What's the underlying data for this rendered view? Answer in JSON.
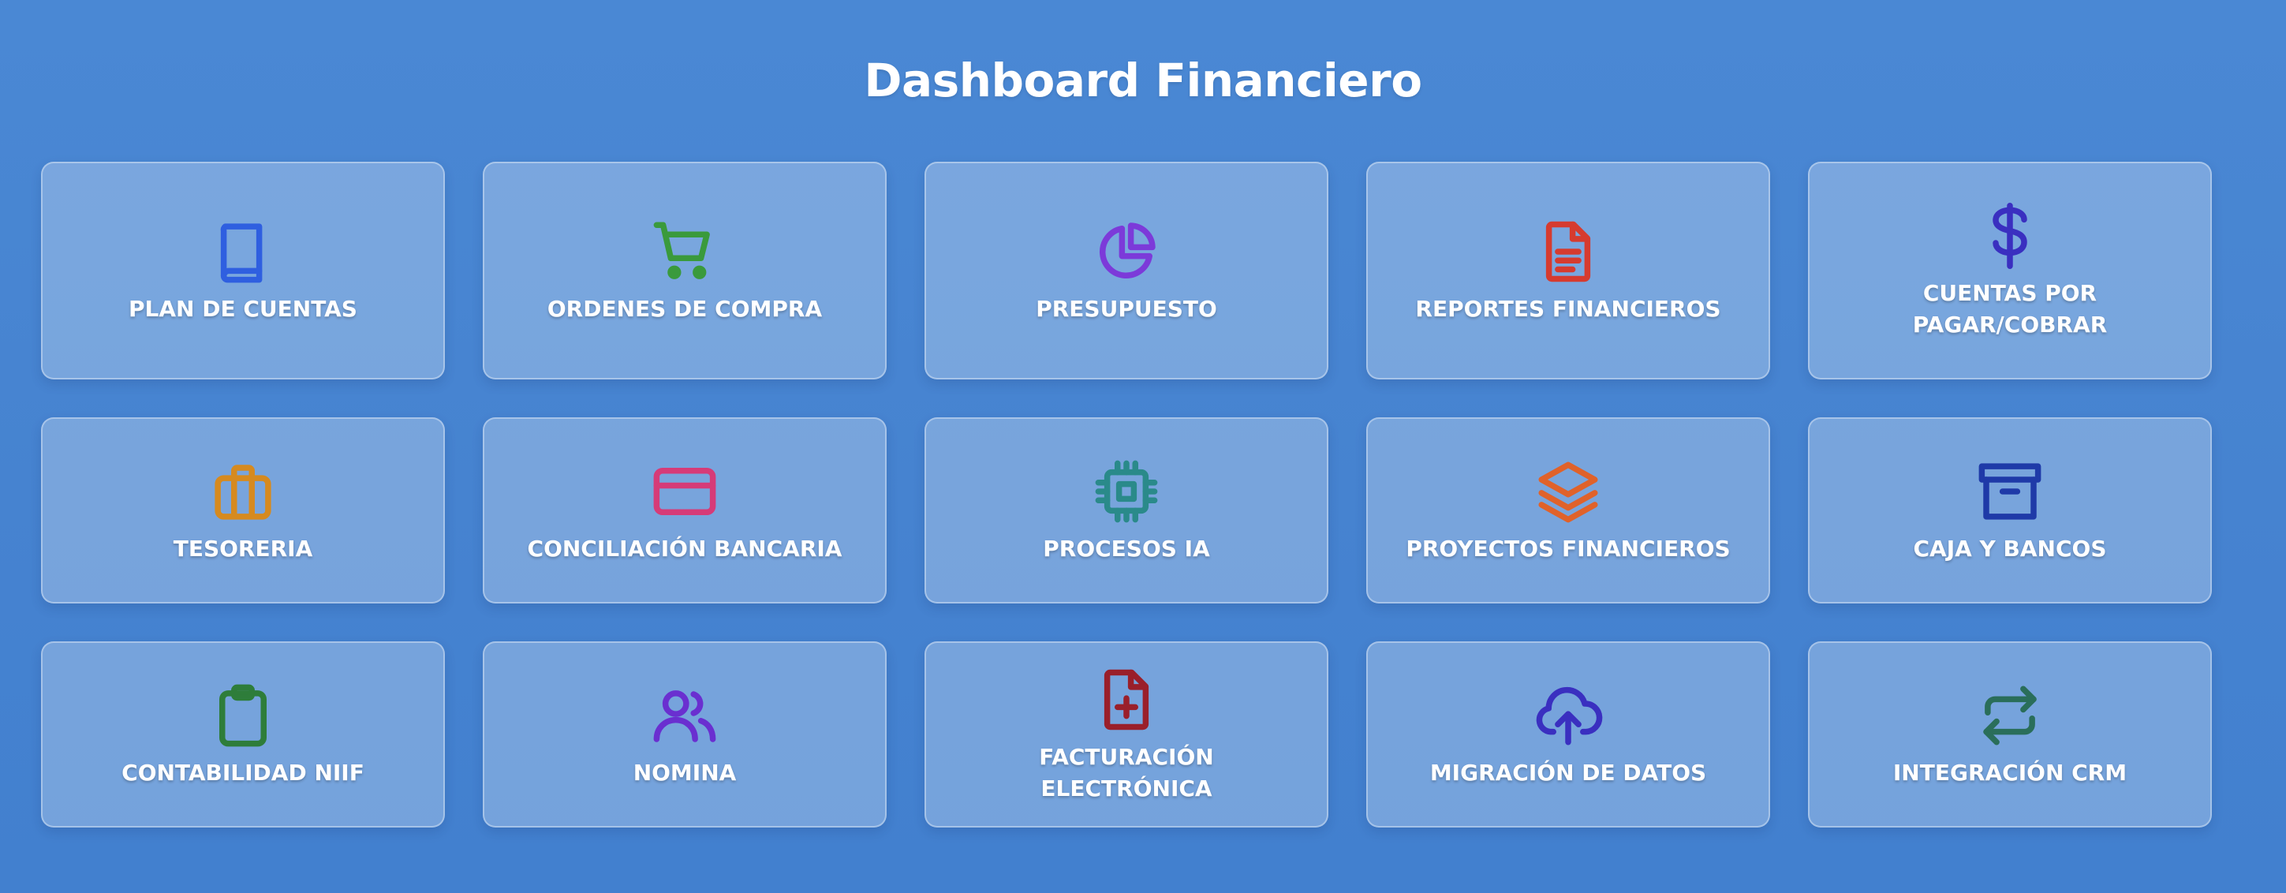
{
  "page": {
    "title": "Dashboard Financiero"
  },
  "cards": [
    {
      "label": "PLAN DE CUENTAS",
      "icon": "book-icon",
      "color": "#2f5fe0"
    },
    {
      "label": "ORDENES DE COMPRA",
      "icon": "shopping-cart-icon",
      "color": "#3a9a3c"
    },
    {
      "label": "PRESUPUESTO",
      "icon": "pie-chart-icon",
      "color": "#7c3ad9"
    },
    {
      "label": "REPORTES FINANCIEROS",
      "icon": "document-text-icon",
      "color": "#d63b2f"
    },
    {
      "label": "CUENTAS POR PAGAR/COBRAR",
      "icon": "dollar-icon",
      "color": "#3a2fc0"
    },
    {
      "label": "TESORERIA",
      "icon": "briefcase-icon",
      "color": "#d68a1f"
    },
    {
      "label": "CONCILIACIÓN BANCARIA",
      "icon": "credit-card-icon",
      "color": "#d63b78"
    },
    {
      "label": "PROCESOS IA",
      "icon": "cpu-chip-icon",
      "color": "#2a8a8a"
    },
    {
      "label": "PROYECTOS FINANCIEROS",
      "icon": "layers-icon",
      "color": "#e0622a"
    },
    {
      "label": "CAJA Y BANCOS",
      "icon": "archive-box-icon",
      "color": "#1f3aa8"
    },
    {
      "label": "CONTABILIDAD NIIF",
      "icon": "clipboard-icon",
      "color": "#2e7d3a"
    },
    {
      "label": "NOMINA",
      "icon": "users-icon",
      "color": "#6a2fd0"
    },
    {
      "label": "FACTURACIÓN ELECTRÓNICA",
      "icon": "document-plus-icon",
      "color": "#9a1f2a"
    },
    {
      "label": "MIGRACIÓN DE DATOS",
      "icon": "cloud-upload-icon",
      "color": "#3a2fc0"
    },
    {
      "label": "INTEGRACIÓN CRM",
      "icon": "arrows-exchange-icon",
      "color": "#2a6e5a"
    }
  ]
}
